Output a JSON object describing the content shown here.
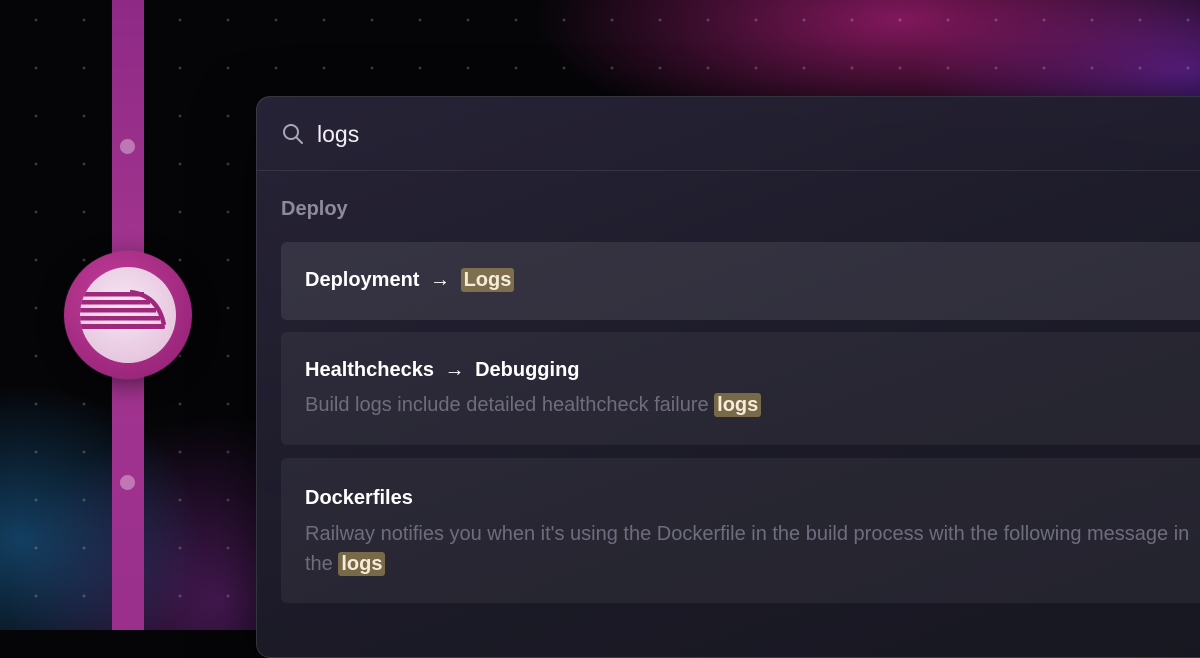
{
  "search": {
    "query": "logs"
  },
  "section": {
    "label": "Deploy"
  },
  "results": [
    {
      "title_prefix": "Deployment",
      "arrow": "→",
      "title_match": "Logs"
    },
    {
      "title_prefix": "Healthchecks",
      "arrow": "→",
      "title_suffix": "Debugging",
      "desc_prefix": "Build logs include detailed healthcheck failure ",
      "desc_match": "logs"
    },
    {
      "title": "Dockerfiles",
      "desc_prefix": "Railway notifies you when it's using the Dockerfile in the build process with the following message in the ",
      "desc_match": "logs"
    }
  ],
  "colors": {
    "rail": "#a3358f",
    "logo": "#b0308c",
    "highlight": "#baa05a"
  },
  "icons": {
    "search": "search-icon",
    "logo": "railway-logo-icon"
  }
}
